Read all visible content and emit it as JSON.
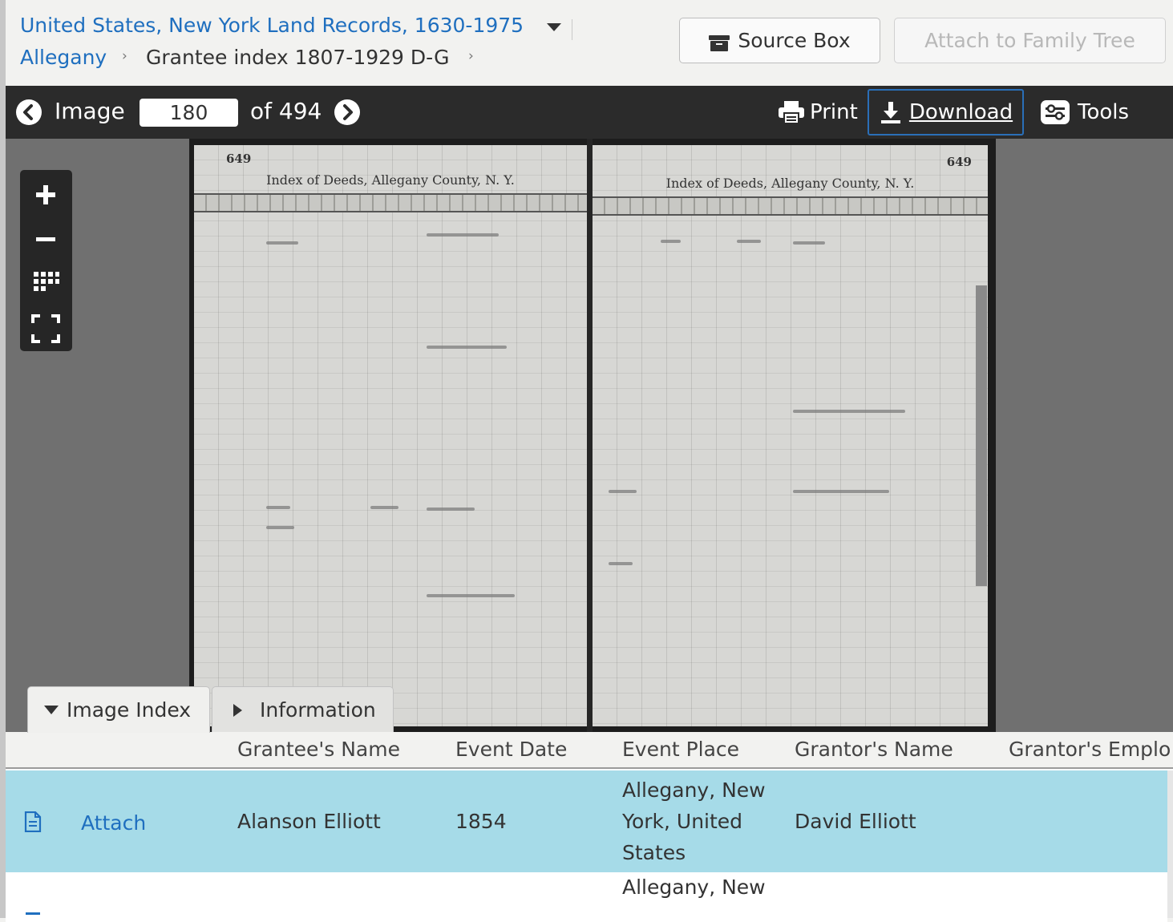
{
  "header": {
    "collection_title": "United States, New York Land Records, 1630-1975",
    "breadcrumb": [
      "Allegany",
      "Grantee index 1807-1929 D-G"
    ],
    "breadcrumb_separator": "›",
    "source_box_label": "Source Box",
    "attach_tree_label": "Attach to Family Tree"
  },
  "toolbar": {
    "image_label": "Image",
    "image_number": "180",
    "of_label": "of 494",
    "print_label": "Print",
    "download_label": "Download",
    "tools_label": "Tools"
  },
  "viewer": {
    "zoom_controls": [
      "zoom-in",
      "zoom-out",
      "grid-view",
      "fullscreen"
    ],
    "ledger": {
      "left_page_number": "649",
      "right_page_number": "649",
      "left_title": "Index of Deeds, Allegany County, N. Y.",
      "right_title": "Index of Deeds, Allegany County, N. Y."
    }
  },
  "tabs": {
    "image_index": "Image Index",
    "information": "Information"
  },
  "table": {
    "columns": [
      "Grantee's Name",
      "Event Date",
      "Event Place",
      "Grantor's Name",
      "Grantor's Emplo"
    ],
    "rows": [
      {
        "action": "Attach",
        "grantee": "Alanson Elliott",
        "date": "1854",
        "place_lines": [
          "Allegany, New",
          "York, United",
          "States"
        ],
        "grantor": "David Elliott",
        "selected": true
      },
      {
        "action": "",
        "grantee": "",
        "date": "",
        "place_lines": [
          "Allegany, New"
        ],
        "grantor": "",
        "selected": false
      }
    ]
  },
  "colors": {
    "link_blue": "#1f6fbf",
    "toolbar_bg": "#2b2b2b",
    "selected_row": "#a6dbe8",
    "viewer_bg": "#707070"
  }
}
